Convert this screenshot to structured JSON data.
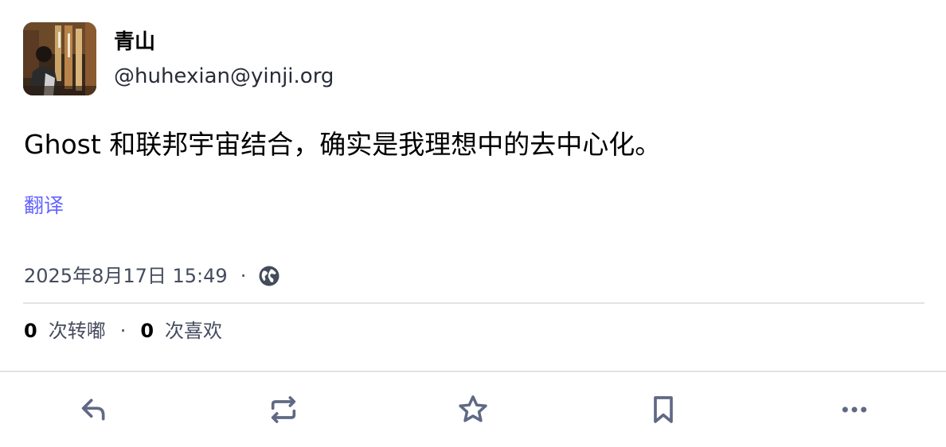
{
  "author": {
    "display_name": "青山",
    "account": "@huhexian@yinji.org",
    "avatar_icon": "avatar-photo"
  },
  "post": {
    "content": "Ghost 和联邦宇宙结合，确实是我理想中的去中心化。",
    "translate_label": "翻译"
  },
  "meta": {
    "timestamp": "2025年8月17日 15:49",
    "separator": "·",
    "visibility_icon": "globe-icon"
  },
  "stats": {
    "reblogs_count": "0",
    "reblogs_label": "次转嘟",
    "separator": "·",
    "favourites_count": "0",
    "favourites_label": "次喜欢"
  },
  "actions": {
    "reply_icon": "reply-icon",
    "boost_icon": "boost-icon",
    "favourite_icon": "star-icon",
    "bookmark_icon": "bookmark-icon",
    "more_icon": "more-icon"
  },
  "colors": {
    "link": "#6364ff",
    "secondary_text": "#444b5d",
    "icon": "#606984",
    "divider": "#e2e3e7"
  }
}
